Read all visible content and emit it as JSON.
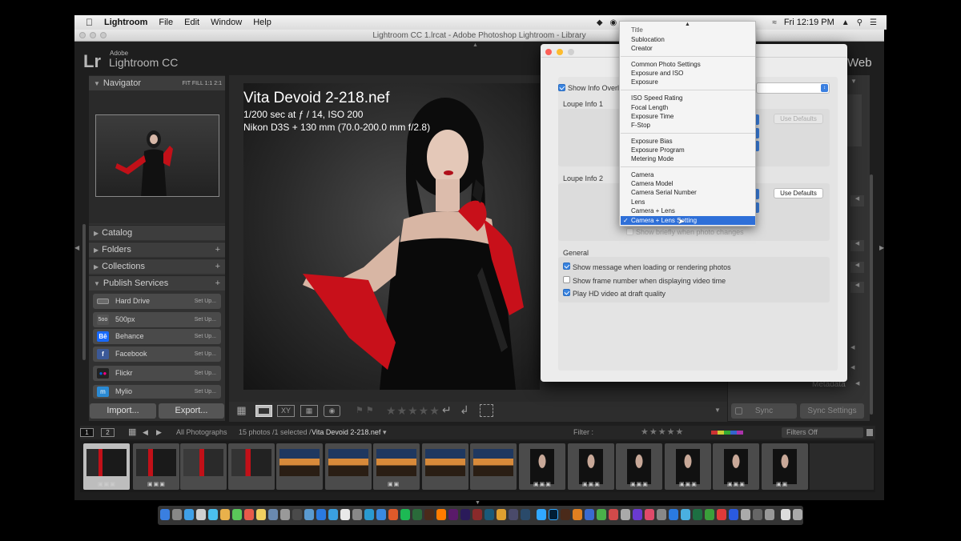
{
  "menubar": {
    "app": "Lightroom",
    "items": [
      "File",
      "Edit",
      "Window",
      "Help"
    ],
    "clock": "Fri 12:19 PM"
  },
  "window": {
    "title": "Lightroom CC 1.lrcat - Adobe Photoshop Lightroom - Library"
  },
  "identity": {
    "lr": "Lr",
    "adobe": "Adobe",
    "product": "Lightroom CC",
    "module": "Web"
  },
  "left_panel": {
    "navigator": "Navigator",
    "nav_options": "FIT  FILL  1:1  2:1",
    "catalog": "Catalog",
    "folders": "Folders",
    "collections": "Collections",
    "publish_services": "Publish Services",
    "plus": "+",
    "services": [
      {
        "name": "Hard Drive",
        "icon": "harddrive-icon",
        "action": "Set Up..."
      },
      {
        "name": "500px",
        "icon": "500px-icon",
        "action": "Set Up..."
      },
      {
        "name": "Behance",
        "icon": "behance-icon",
        "action": "Set Up..."
      },
      {
        "name": "Facebook",
        "icon": "facebook-icon",
        "action": "Set Up..."
      },
      {
        "name": "Flickr",
        "icon": "flickr-icon",
        "action": "Set Up..."
      },
      {
        "name": "Mylio",
        "icon": "mylio-icon",
        "action": "Set Up..."
      }
    ],
    "import": "Import...",
    "export": "Export..."
  },
  "photo_info": {
    "filename": "Vita Devoid 2-218.nef",
    "exposure": "1/200 sec at ƒ / 14, ISO 200",
    "camera": "Nikon D3S + 130 mm (70.0-200.0 mm f/2.8)"
  },
  "dialog": {
    "show_info_overlay": "Show Info Overlay",
    "loupe_info_1": "Loupe Info 1",
    "loupe_info_2": "Loupe Info 2",
    "use_defaults": "Use Defaults",
    "show_briefly": "Show briefly when photo changes",
    "general": "General",
    "opt1": "Show message when loading or rendering photos",
    "opt2": "Show frame number when displaying video time",
    "opt3": "Play HD video at draft quality"
  },
  "dropdown": {
    "items_top": [
      "Title",
      "Sublocation",
      "Creator"
    ],
    "items_g2": [
      "Common Photo Settings",
      "Exposure and ISO",
      "Exposure"
    ],
    "items_g3": [
      "ISO Speed Rating",
      "Focal Length",
      "Exposure Time",
      "F-Stop"
    ],
    "items_g4": [
      "Exposure Bias",
      "Exposure Program",
      "Metering Mode"
    ],
    "items_g5": [
      "Camera",
      "Camera Model",
      "Camera Serial Number",
      "Lens",
      "Camera + Lens"
    ],
    "selected": "Camera + Lens Setting",
    "check": "✓"
  },
  "right_panel": {
    "sync": "Sync",
    "sync_settings": "Sync Settings",
    "metadata": "Metadata"
  },
  "filmbar": {
    "mon1": "1",
    "mon2": "2",
    "source": "All Photographs",
    "count": "15 photos /1 selected /",
    "current": "Vita Devoid 2-218.nef",
    "filter_label": "Filter :",
    "filters_off": "Filters Off"
  },
  "colors": {
    "accent": "#2e6fd8",
    "panel": "#313131",
    "background": "#1e1e1e"
  }
}
